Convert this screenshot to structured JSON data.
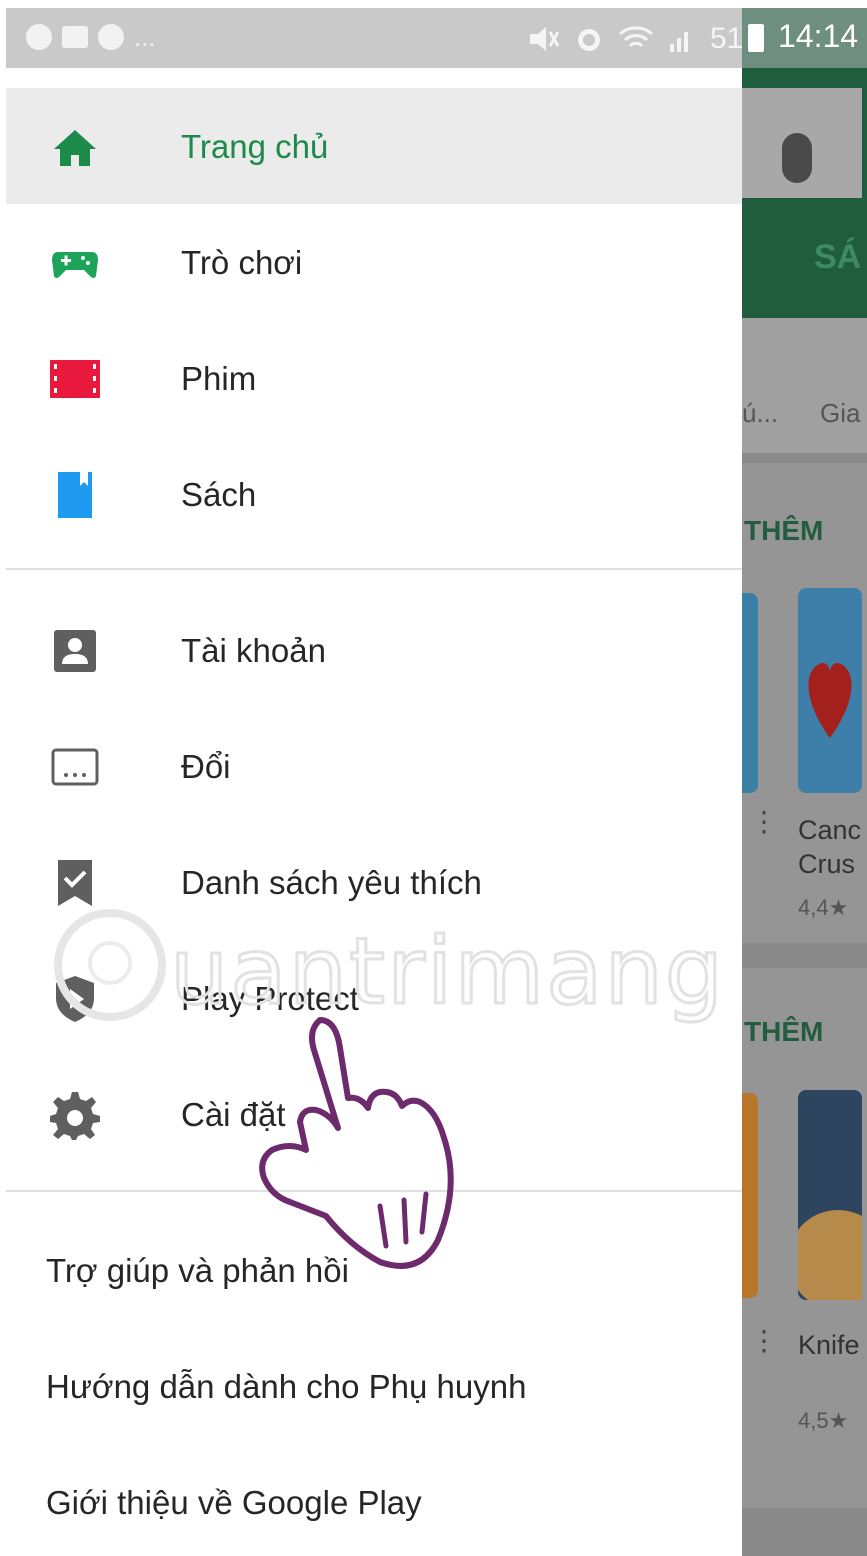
{
  "status_bar": {
    "ellipsis": "...",
    "battery_percent": "51%",
    "clock": "14:14"
  },
  "drawer": {
    "primary_items": [
      {
        "label": "Trang chủ",
        "icon": "home-icon",
        "active": true,
        "color": "#1c8a4a"
      },
      {
        "label": "Trò chơi",
        "icon": "gamepad-icon",
        "active": false,
        "color": "#1ea35a"
      },
      {
        "label": "Phim",
        "icon": "film-icon",
        "active": false,
        "color": "#e8193c"
      },
      {
        "label": "Sách",
        "icon": "book-icon",
        "active": false,
        "color": "#1e9bf0"
      }
    ],
    "secondary_items": [
      {
        "label": "Tài khoản",
        "icon": "account-icon"
      },
      {
        "label": "Đổi",
        "icon": "redeem-icon"
      },
      {
        "label": "Danh sách yêu thích",
        "icon": "wishlist-icon"
      },
      {
        "label": "Play Protect",
        "icon": "play-protect-icon"
      },
      {
        "label": "Cài đặt",
        "icon": "settings-gear-icon"
      }
    ],
    "text_items": [
      "Trợ giúp và phản hồi",
      "Hướng dẫn dành cho Phụ huynh",
      "Giới thiệu về Google Play"
    ]
  },
  "background_app": {
    "tab_partial": "SÁ",
    "category_partial_1": "ú...",
    "category_partial_2": "Gia",
    "more_label_1": "THÊM",
    "more_label_2": "THÊM",
    "app1_name": "Canc Crus",
    "app1_rating": "4,4★",
    "app2_name": "Knife",
    "app2_rating": "4,5★"
  },
  "watermark_text": "Quantrimang",
  "accent_color": "#1c8a4a"
}
